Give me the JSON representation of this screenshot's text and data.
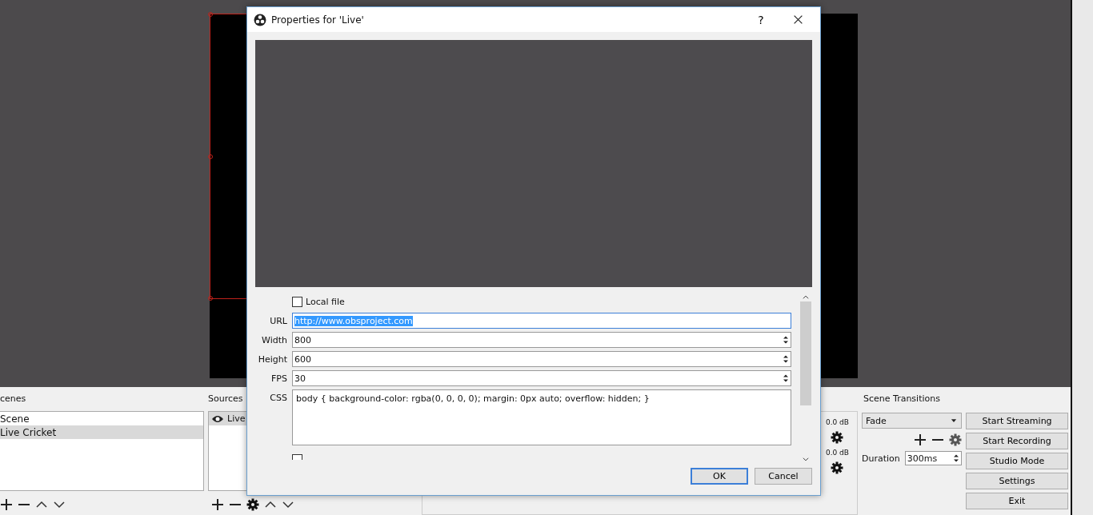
{
  "scenes": {
    "title": "cenes",
    "items": [
      {
        "name": "Scene",
        "selected": false
      },
      {
        "name": "Live Cricket",
        "selected": true
      }
    ]
  },
  "sources": {
    "title": "Sources",
    "items": [
      {
        "name": "Live",
        "visible": true,
        "selected": true
      }
    ]
  },
  "mixer": {
    "channels": [
      {
        "reading": "0.0 dB"
      },
      {
        "reading": "0.0 dB"
      }
    ]
  },
  "transitions": {
    "title": "Scene Transitions",
    "selected": "Fade",
    "duration_label": "Duration",
    "duration": "300ms"
  },
  "controls": [
    "Start Streaming",
    "Start Recording",
    "Studio Mode",
    "Settings",
    "Exit"
  ],
  "dialog": {
    "title": "Properties for 'Live'",
    "help": "?",
    "local_file": {
      "label": "Local file",
      "checked": false
    },
    "fields": [
      {
        "label": "URL",
        "value": "http://www.obsproject.com",
        "kind": "text",
        "highlighted": true
      },
      {
        "label": "Width",
        "value": "800",
        "kind": "spin",
        "highlighted": false
      },
      {
        "label": "Height",
        "value": "600",
        "kind": "spin",
        "highlighted": false
      },
      {
        "label": "FPS",
        "value": "30",
        "kind": "spin",
        "highlighted": false
      },
      {
        "label": "CSS",
        "value": "body { background-color: rgba(0, 0, 0, 0); margin: 0px auto; overflow: hidden; }",
        "kind": "area",
        "highlighted": false
      }
    ],
    "shutdown": {
      "checked": false
    },
    "buttons": [
      {
        "label": "OK",
        "default": true
      },
      {
        "label": "Cancel",
        "default": false
      }
    ]
  }
}
